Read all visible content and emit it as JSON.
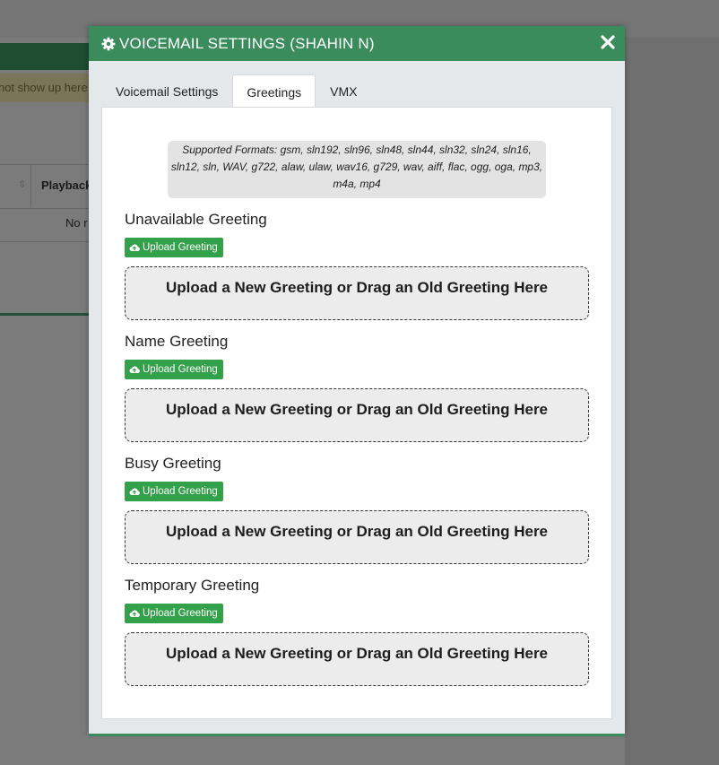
{
  "background": {
    "notice_text": "not show up here",
    "table_header": "Playback",
    "table_row_text": "No r"
  },
  "modal": {
    "title": "VOICEMAIL SETTINGS (SHAHIN N)",
    "title_icon": "gear-icon",
    "close_icon": "close-icon"
  },
  "tabs": [
    {
      "label": "Voicemail Settings",
      "active": false
    },
    {
      "label": "Greetings",
      "active": true
    },
    {
      "label": "VMX",
      "active": false
    }
  ],
  "formats": {
    "text": "Supported Formats: gsm, sln192, sln96, sln48, sln44, sln32, sln24, sln16, sln12, sln, WAV, g722, alaw, ulaw, wav16, g729, wav, aiff, flac, ogg, oga, mp3, m4a, mp4"
  },
  "greetings": [
    {
      "title": "Unavailable Greeting",
      "upload_label": "Upload Greeting",
      "dropzone_text": "Upload a New Greeting or Drag an Old Greeting Here"
    },
    {
      "title": "Name Greeting",
      "upload_label": "Upload Greeting",
      "dropzone_text": "Upload a New Greeting or Drag an Old Greeting Here"
    },
    {
      "title": "Busy Greeting",
      "upload_label": "Upload Greeting",
      "dropzone_text": "Upload a New Greeting or Drag an Old Greeting Here"
    },
    {
      "title": "Temporary Greeting",
      "upload_label": "Upload Greeting",
      "dropzone_text": "Upload a New Greeting or Drag an Old Greeting Here"
    }
  ],
  "colors": {
    "header_green": "#3a8c5c",
    "button_green": "#33a04a"
  }
}
